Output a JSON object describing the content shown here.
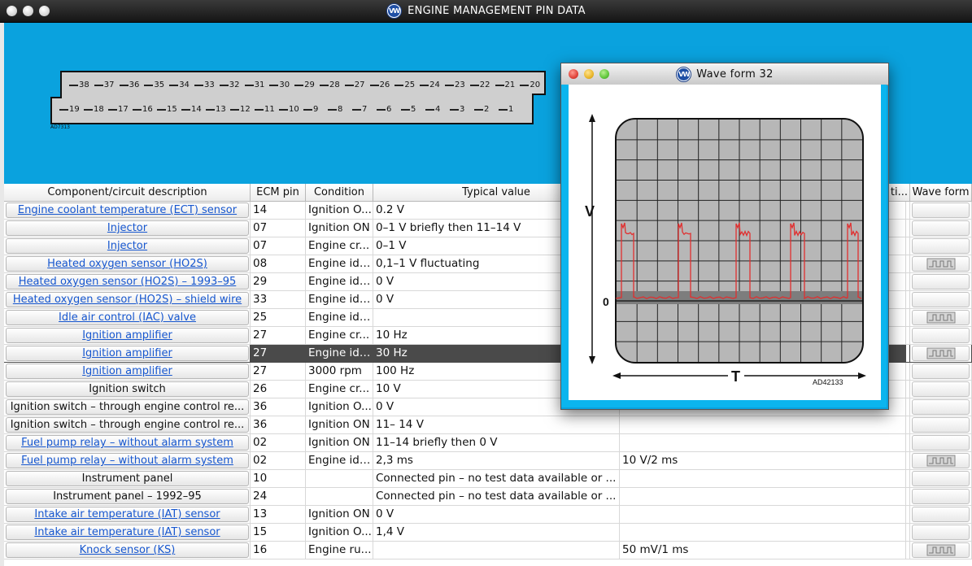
{
  "window": {
    "title": "ENGINE MANAGEMENT PIN DATA",
    "logo": "vw-logo-icon"
  },
  "connector": {
    "top_pins": [
      "38",
      "37",
      "36",
      "35",
      "34",
      "33",
      "32",
      "31",
      "30",
      "29",
      "28",
      "27",
      "26",
      "25",
      "24",
      "23",
      "22",
      "21",
      "20"
    ],
    "bottom_pins": [
      "19",
      "18",
      "17",
      "16",
      "15",
      "14",
      "13",
      "12",
      "11",
      "10",
      "9",
      "8",
      "7",
      "6",
      "5",
      "4",
      "3",
      "2",
      "1"
    ],
    "label": "AD7313"
  },
  "table": {
    "headers": [
      "Component/circuit description",
      "ECM pin",
      "Condition",
      "Typical value",
      "ti...",
      "Wave form"
    ],
    "rows": [
      {
        "desc": "Engine coolant temperature (ECT) sensor",
        "link": true,
        "pin": "14",
        "cond": "Ignition O...",
        "value": "0.2 V",
        "extra": "",
        "wave": false
      },
      {
        "desc": "Injector",
        "link": true,
        "pin": "07",
        "cond": "Ignition ON",
        "value": "0–1 V briefly then 11–14 V",
        "extra": "",
        "wave": false
      },
      {
        "desc": "Injector",
        "link": true,
        "pin": "07",
        "cond": "Engine cr...",
        "value": "0–1 V",
        "extra": "",
        "wave": false
      },
      {
        "desc": "Heated oxygen sensor (HO2S)",
        "link": true,
        "pin": "08",
        "cond": "Engine idl...",
        "value": "0,1–1 V fluctuating",
        "extra": "",
        "wave": true
      },
      {
        "desc": "Heated oxygen sensor (HO2S) – 1993–95",
        "link": true,
        "pin": "29",
        "cond": "Engine idl...",
        "value": "0 V",
        "extra": "",
        "wave": false
      },
      {
        "desc": "Heated oxygen sensor (HO2S) – shield wire",
        "link": true,
        "pin": "33",
        "cond": "Engine idl...",
        "value": "0 V",
        "extra": "",
        "wave": false
      },
      {
        "desc": "Idle air control (IAC) valve",
        "link": true,
        "pin": "25",
        "cond": "Engine idl...",
        "value": "",
        "extra": "",
        "wave": true
      },
      {
        "desc": "Ignition amplifier",
        "link": true,
        "pin": "27",
        "cond": "Engine cr...",
        "value": "10 Hz",
        "extra": "",
        "wave": false
      },
      {
        "desc": "Ignition amplifier",
        "link": true,
        "pin": "27",
        "cond": "Engine idl...",
        "value": "30 Hz",
        "extra": "",
        "wave": true,
        "selected": true
      },
      {
        "desc": "Ignition amplifier",
        "link": true,
        "pin": "27",
        "cond": "3000 rpm",
        "value": "100 Hz",
        "extra": "",
        "wave": false
      },
      {
        "desc": "Ignition switch",
        "link": false,
        "pin": "26",
        "cond": "Engine cr...",
        "value": "10 V",
        "extra": "",
        "wave": false
      },
      {
        "desc": "Ignition switch – through engine control re...",
        "link": false,
        "pin": "36",
        "cond": "Ignition O...",
        "value": "0 V",
        "extra": "",
        "wave": false
      },
      {
        "desc": "Ignition switch – through engine control re...",
        "link": false,
        "pin": "36",
        "cond": "Ignition ON",
        "value": "11– 14 V",
        "extra": "",
        "wave": false
      },
      {
        "desc": "Fuel pump relay – without alarm system",
        "link": true,
        "pin": "02",
        "cond": "Ignition ON",
        "value": "11–14 briefly then 0 V",
        "extra": "",
        "wave": false
      },
      {
        "desc": "Fuel pump relay – without alarm system",
        "link": true,
        "pin": "02",
        "cond": "Engine idl...",
        "value": "2,3 ms",
        "extra": "10 V/2 ms",
        "wave": true
      },
      {
        "desc": "Instrument panel",
        "link": false,
        "pin": "10",
        "cond": "",
        "value": "Connected pin – no test data available or ...",
        "extra": "",
        "wave": false
      },
      {
        "desc": "Instrument panel – 1992–95",
        "link": false,
        "pin": "24",
        "cond": "",
        "value": "Connected pin – no test data available or ...",
        "extra": "",
        "wave": false
      },
      {
        "desc": "Intake air temperature (IAT) sensor",
        "link": true,
        "pin": "13",
        "cond": "Ignition ON",
        "value": "0 V",
        "extra": "",
        "wave": false
      },
      {
        "desc": "Intake air temperature (IAT) sensor",
        "link": true,
        "pin": "15",
        "cond": "Ignition O...",
        "value": "1,4 V",
        "extra": "",
        "wave": false
      },
      {
        "desc": "Knock sensor (KS)",
        "link": true,
        "pin": "16",
        "cond": "Engine ru...",
        "value": "",
        "extra": "50 mV/1 ms",
        "wave": true
      }
    ]
  },
  "waveform_window": {
    "title": "Wave form 32",
    "y_axis_label": "V",
    "zero_label": "0",
    "x_axis_label": "T",
    "figure_id": "AD42133",
    "trace_color": "#e03030"
  }
}
